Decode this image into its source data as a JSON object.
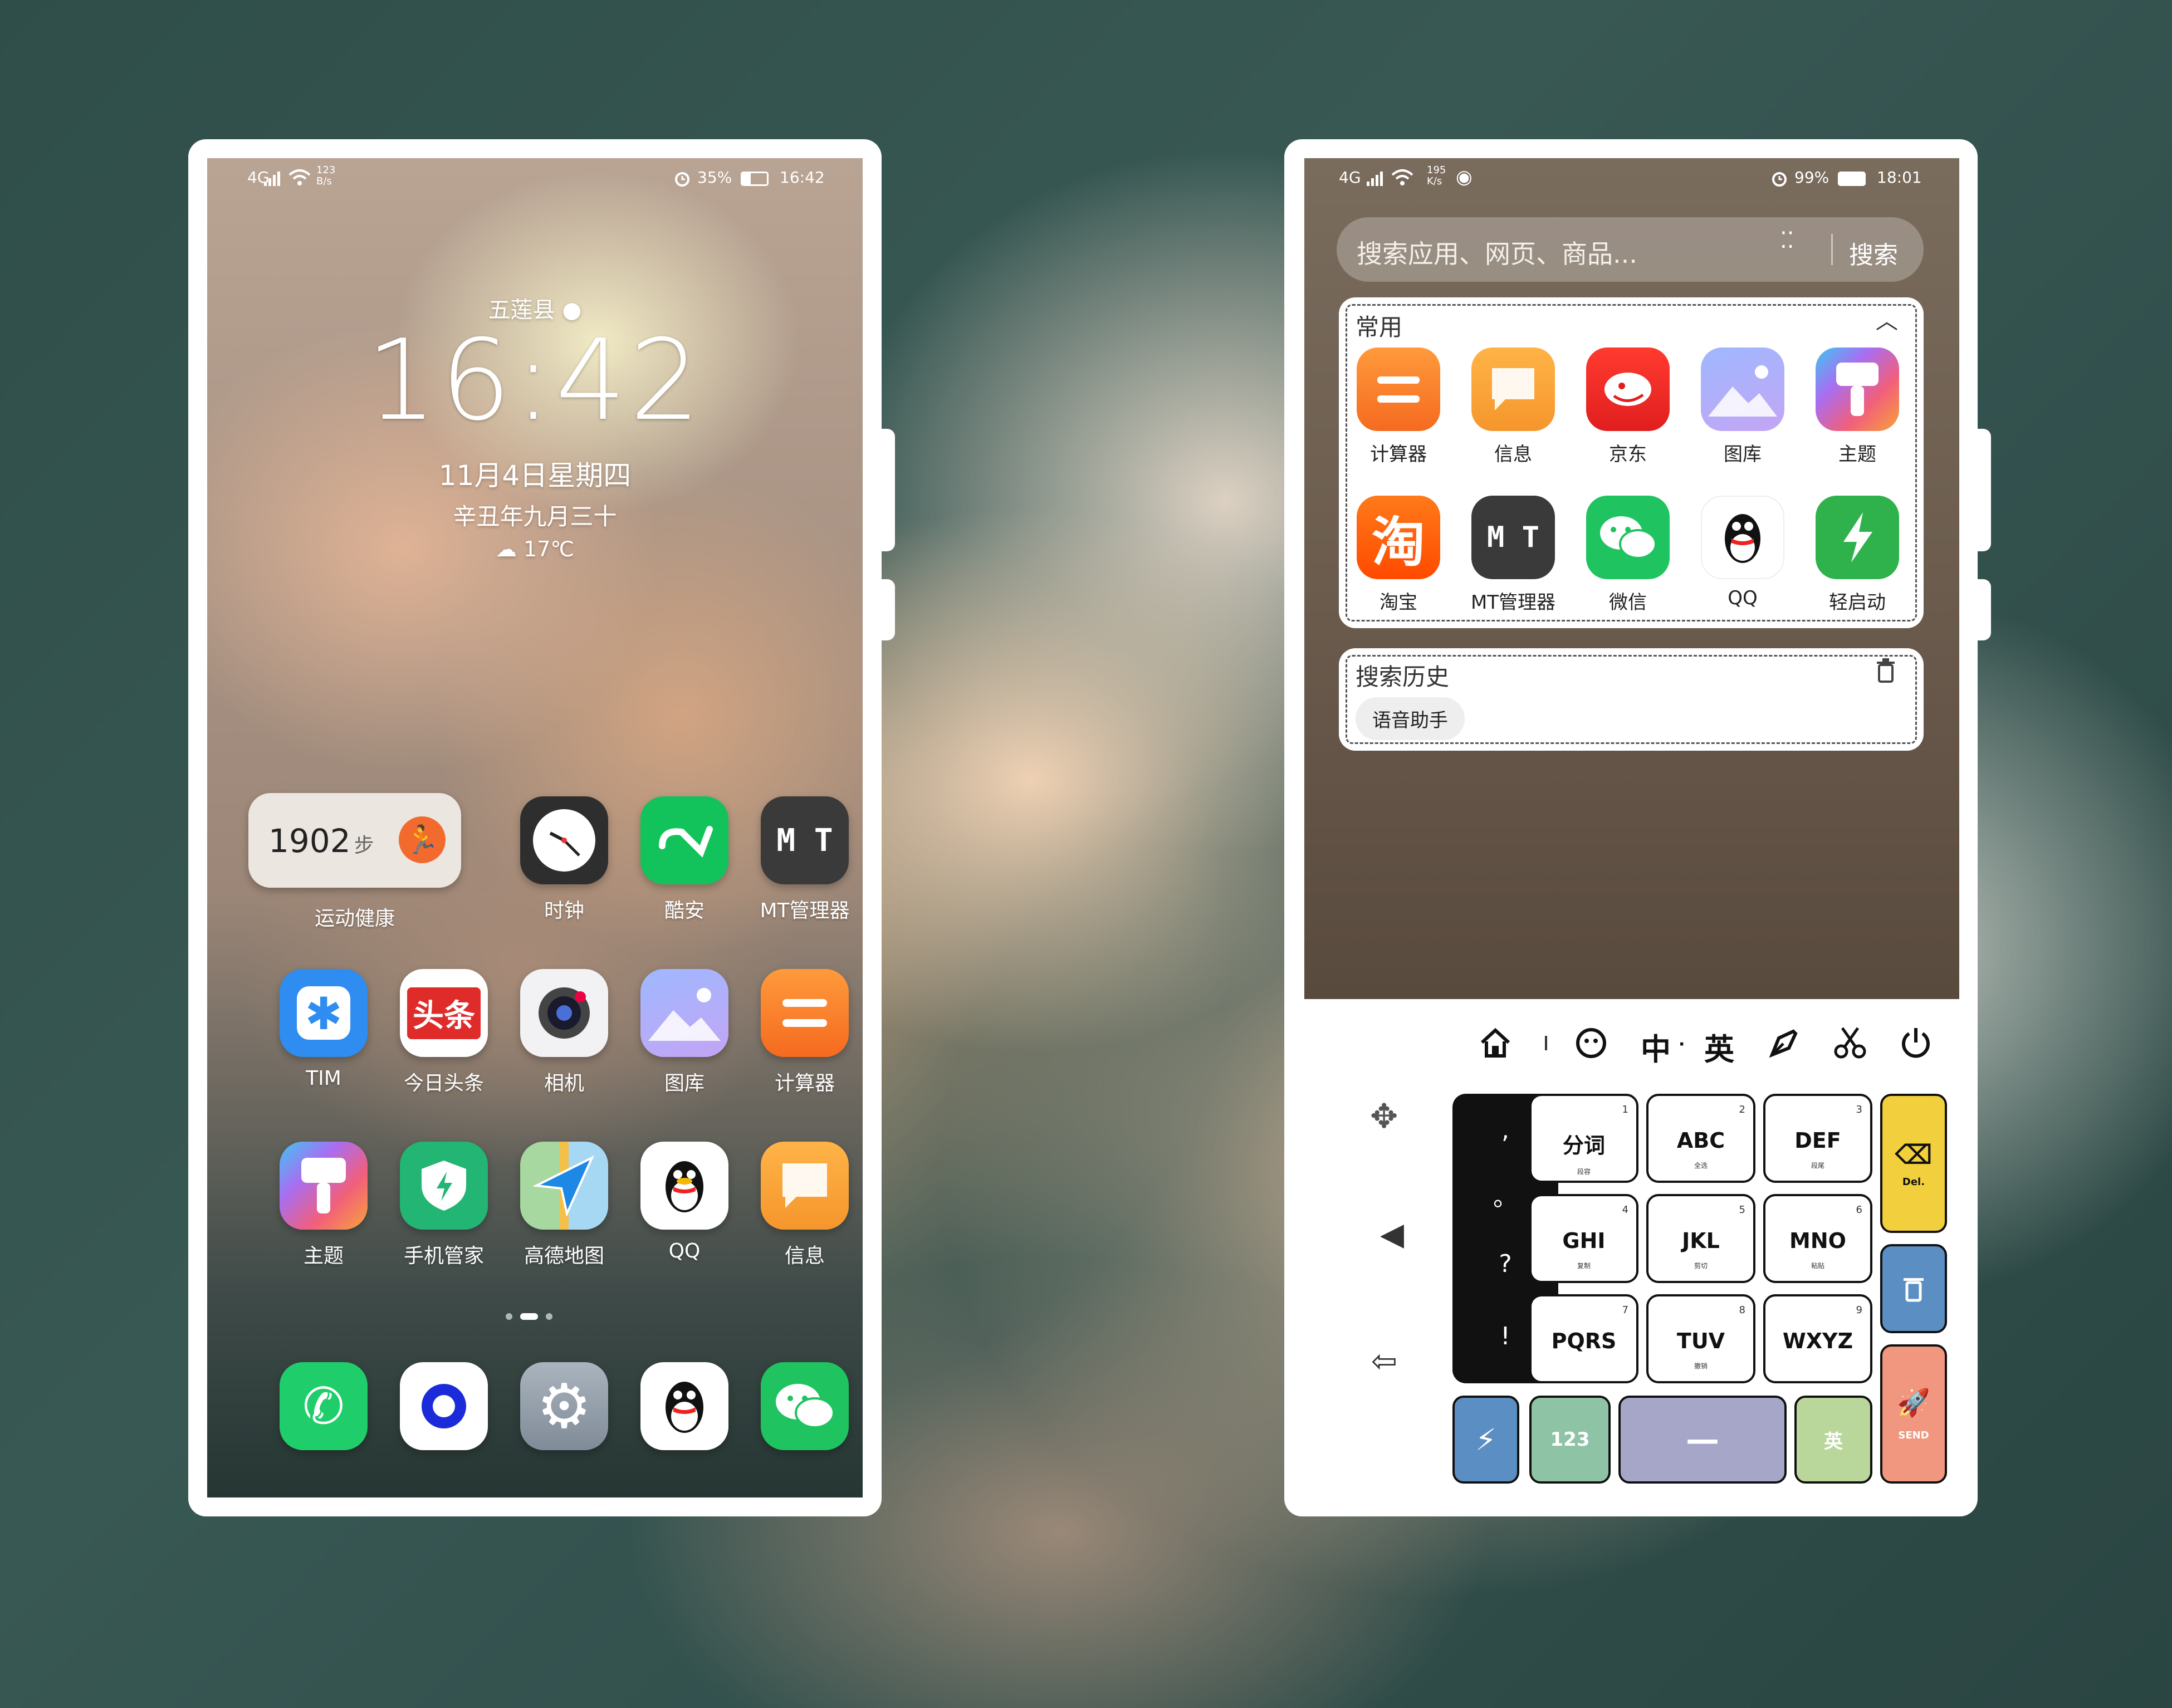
{
  "left_phone": {
    "status": {
      "network": "4G",
      "speed": "123\nB/s",
      "battery": "35%",
      "time": "16:42"
    },
    "clock_widget": {
      "location": "五莲县",
      "time": "16:42",
      "date": "11月4日星期四",
      "lunar": "辛丑年九月三十",
      "temperature": "17℃"
    },
    "step_widget": {
      "steps": "1902",
      "unit": "步",
      "label": "运动健康"
    },
    "apps_row1": [
      {
        "label": "时钟"
      },
      {
        "label": "酷安"
      },
      {
        "label": "MT管理器"
      }
    ],
    "apps_row2": [
      {
        "label": "TIM"
      },
      {
        "label": "今日头条",
        "icon_text": "头条"
      },
      {
        "label": "相机"
      },
      {
        "label": "图库"
      },
      {
        "label": "计算器"
      }
    ],
    "apps_row3": [
      {
        "label": "主题"
      },
      {
        "label": "手机管家"
      },
      {
        "label": "高德地图"
      },
      {
        "label": "QQ"
      },
      {
        "label": "信息"
      }
    ],
    "dock": [
      {
        "name": "phone-icon"
      },
      {
        "name": "browser-icon"
      },
      {
        "name": "settings-icon"
      },
      {
        "name": "qq-icon"
      },
      {
        "name": "wechat-icon"
      }
    ],
    "mt_icon_text": "M T"
  },
  "right_phone": {
    "status": {
      "network": "4G",
      "speed": "195\nK/s",
      "battery": "99%",
      "time": "18:01"
    },
    "search": {
      "placeholder": "搜索应用、网页、商品...",
      "button": "搜索"
    },
    "frequent": {
      "title": "常用",
      "apps": [
        {
          "label": "计算器"
        },
        {
          "label": "信息"
        },
        {
          "label": "京东"
        },
        {
          "label": "图库"
        },
        {
          "label": "主题"
        },
        {
          "label": "淘宝",
          "icon_text": "淘"
        },
        {
          "label": "MT管理器",
          "icon_text": "M T"
        },
        {
          "label": "微信"
        },
        {
          "label": "QQ"
        },
        {
          "label": "轻启动"
        }
      ]
    },
    "history": {
      "title": "搜索历史",
      "items": [
        "语音助手"
      ]
    },
    "keyboard": {
      "toolbar": {
        "zh": "中",
        "dot": "·",
        "en": "英"
      },
      "punct": [
        ",",
        "。",
        "?",
        "!"
      ],
      "keys": [
        {
          "k": "分词",
          "n": "1",
          "s": "段容"
        },
        {
          "k": "ABC",
          "n": "2",
          "s": "全选"
        },
        {
          "k": "DEF",
          "n": "3",
          "s": "段尾"
        },
        {
          "k": "GHI",
          "n": "4",
          "s": "复制"
        },
        {
          "k": "JKL",
          "n": "5",
          "s": "剪切"
        },
        {
          "k": "MNO",
          "n": "6",
          "s": "粘贴"
        },
        {
          "k": "PQRS",
          "n": "7",
          "s": ""
        },
        {
          "k": "TUV",
          "n": "8",
          "s": "撤销"
        },
        {
          "k": "WXYZ",
          "n": "9",
          "s": ""
        }
      ],
      "del_label": "Del.",
      "send_label": "SEND",
      "num_label": "123",
      "space_label": "—",
      "en_label": "英"
    }
  },
  "colors": {
    "accent_yellow": "#f2cf3c",
    "accent_blue": "#5b8ec3",
    "accent_red": "#f2977f",
    "key_green": "#8fc3a6",
    "space_purple": "#a6a6c8",
    "en_green": "#b9d69b"
  }
}
